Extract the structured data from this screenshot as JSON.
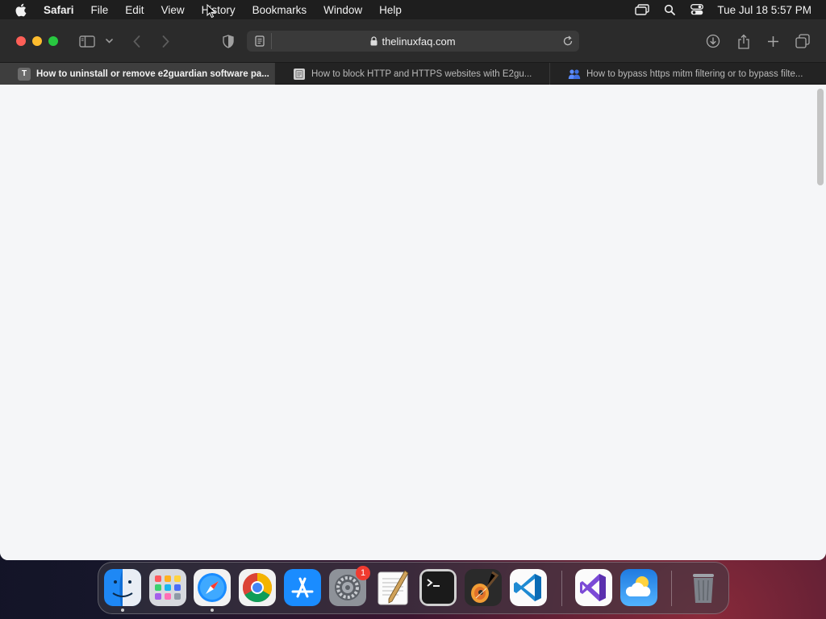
{
  "menubar": {
    "app_name": "Safari",
    "items": [
      "File",
      "Edit",
      "View",
      "History",
      "Bookmarks",
      "Window",
      "Help"
    ],
    "clock": "Tue Jul 18  5:57 PM"
  },
  "toolbar": {
    "url": "thelinuxfaq.com"
  },
  "tabs": [
    {
      "title": "How to uninstall or remove e2guardian software pa...",
      "favicon": "T",
      "active": true
    },
    {
      "title": "How to block HTTP and HTTPS websites with E2gu...",
      "favicon": "page-icon",
      "active": false
    },
    {
      "title": "How to bypass https mitm filtering or to bypass filte...",
      "favicon": "people-icon",
      "active": false
    }
  ],
  "dock": {
    "apps": [
      "Finder",
      "Launchpad",
      "Safari",
      "Google Chrome",
      "App Store",
      "System Settings",
      "TextEdit",
      "Terminal",
      "GarageBand",
      "Visual Studio Code",
      "Visual Studio",
      "Weather",
      "Trash"
    ],
    "system_settings_badge": "1"
  }
}
